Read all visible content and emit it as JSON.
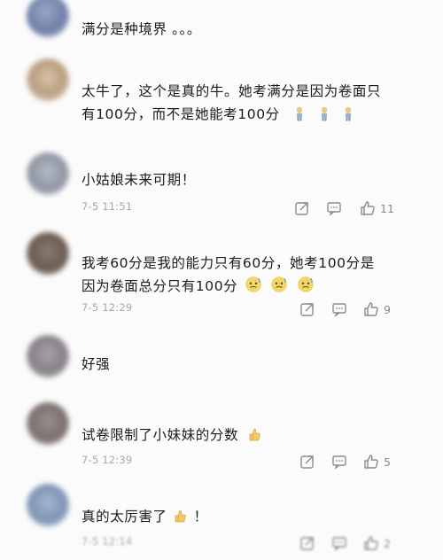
{
  "comments": [
    {
      "text": "满分是种境界 。。。"
    },
    {
      "text_line1": "太牛了，这个是真的牛。她考满分是因为卷面只",
      "text_line2": "有100分，而不是她能考100分"
    },
    {
      "text": "小姑娘未来可期！",
      "time": "7-5 11:51",
      "likes": "11"
    },
    {
      "text_line1": "我考60分是我的能力只有60分，她考100分是",
      "text_line2": "因为卷面总分只有100分",
      "time": "7-5 12:29",
      "likes": "9"
    },
    {
      "text": "好强"
    },
    {
      "text": "试卷限制了小妹妹的分数",
      "time": "7-5 12:39",
      "likes": "5"
    },
    {
      "text": "真的太厉害了",
      "text_suffix": "！",
      "time": "7-5 12:14",
      "likes": "2"
    }
  ],
  "icons": {
    "share": "share-icon",
    "reply": "comment-icon",
    "like": "thumbs-up-icon"
  },
  "colors": {
    "icon": "#8c8c8c",
    "time": "#a8a8a8"
  }
}
